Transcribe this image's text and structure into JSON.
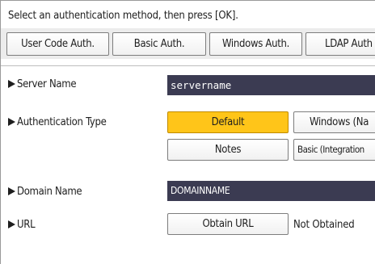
{
  "instruction": "Select an authentication method, then press [OK].",
  "methods": [
    {
      "label": "User Code Auth."
    },
    {
      "label": "Basic Auth."
    },
    {
      "label": "Windows Auth."
    },
    {
      "label": "LDAP Auth"
    }
  ],
  "server_name": {
    "label": "Server Name",
    "value": "servername"
  },
  "auth_type": {
    "label": "Authentication Type",
    "options": [
      "Default",
      "Windows (Na",
      "Notes",
      "Basic (Integration"
    ],
    "selected": "Default"
  },
  "domain_name": {
    "label": "Domain Name",
    "value": "DOMAINNAME"
  },
  "url": {
    "label": "URL",
    "button_label": "Obtain URL",
    "status": "Not Obtained"
  },
  "colors": {
    "selected": "#ffc519",
    "field_bg": "#3b3b52",
    "bar_bg": "#ececec"
  }
}
